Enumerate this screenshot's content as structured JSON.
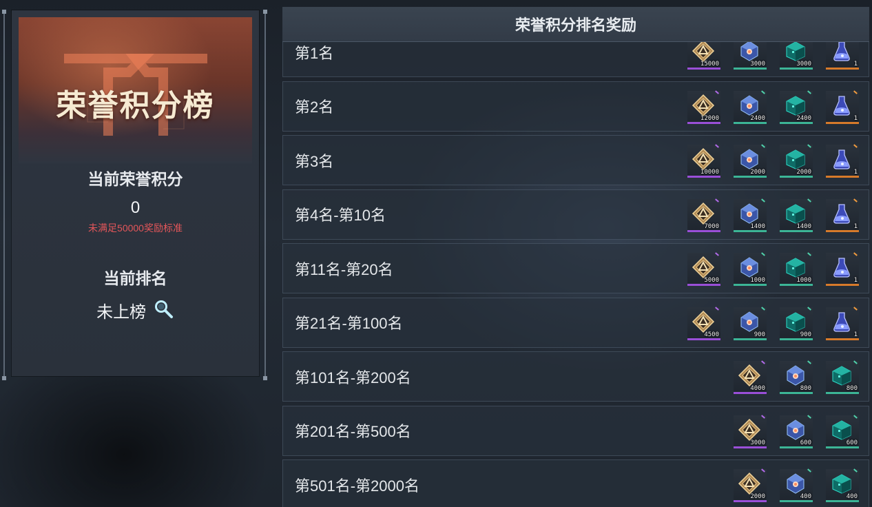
{
  "left": {
    "title": "荣誉积分榜",
    "current_score_label": "当前荣誉积分",
    "current_score_value": "0",
    "score_warning": "未满足50000奖励标准",
    "current_rank_label": "当前排名",
    "current_rank_value": "未上榜"
  },
  "right": {
    "header": "荣誉积分排名奖励",
    "rows": [
      {
        "rank": "第1名",
        "rewards": [
          {
            "icon": "honor-medal-icon",
            "rarity": "purple",
            "qty": "15000"
          },
          {
            "icon": "crystal-orb-icon",
            "rarity": "green",
            "qty": "3000"
          },
          {
            "icon": "teal-cube-icon",
            "rarity": "green",
            "qty": "3000"
          },
          {
            "icon": "blue-flask-icon",
            "rarity": "orange",
            "qty": "1"
          }
        ]
      },
      {
        "rank": "第2名",
        "rewards": [
          {
            "icon": "honor-medal-icon",
            "rarity": "purple",
            "qty": "12000"
          },
          {
            "icon": "crystal-orb-icon",
            "rarity": "green",
            "qty": "2400"
          },
          {
            "icon": "teal-cube-icon",
            "rarity": "green",
            "qty": "2400"
          },
          {
            "icon": "blue-flask-icon",
            "rarity": "orange",
            "qty": "1"
          }
        ]
      },
      {
        "rank": "第3名",
        "rewards": [
          {
            "icon": "honor-medal-icon",
            "rarity": "purple",
            "qty": "10000"
          },
          {
            "icon": "crystal-orb-icon",
            "rarity": "green",
            "qty": "2000"
          },
          {
            "icon": "teal-cube-icon",
            "rarity": "green",
            "qty": "2000"
          },
          {
            "icon": "blue-flask-icon",
            "rarity": "orange",
            "qty": "1"
          }
        ]
      },
      {
        "rank": "第4名-第10名",
        "rewards": [
          {
            "icon": "honor-medal-icon",
            "rarity": "purple",
            "qty": "7000"
          },
          {
            "icon": "crystal-orb-icon",
            "rarity": "green",
            "qty": "1400"
          },
          {
            "icon": "teal-cube-icon",
            "rarity": "green",
            "qty": "1400"
          },
          {
            "icon": "blue-flask-icon",
            "rarity": "orange",
            "qty": "1"
          }
        ]
      },
      {
        "rank": "第11名-第20名",
        "rewards": [
          {
            "icon": "honor-medal-icon",
            "rarity": "purple",
            "qty": "5000"
          },
          {
            "icon": "crystal-orb-icon",
            "rarity": "green",
            "qty": "1000"
          },
          {
            "icon": "teal-cube-icon",
            "rarity": "green",
            "qty": "1000"
          },
          {
            "icon": "blue-flask-icon",
            "rarity": "orange",
            "qty": "1"
          }
        ]
      },
      {
        "rank": "第21名-第100名",
        "rewards": [
          {
            "icon": "honor-medal-icon",
            "rarity": "purple",
            "qty": "4500"
          },
          {
            "icon": "crystal-orb-icon",
            "rarity": "green",
            "qty": "900"
          },
          {
            "icon": "teal-cube-icon",
            "rarity": "green",
            "qty": "900"
          },
          {
            "icon": "blue-flask-icon",
            "rarity": "orange",
            "qty": "1"
          }
        ]
      },
      {
        "rank": "第101名-第200名",
        "rewards": [
          {
            "icon": "honor-medal-icon",
            "rarity": "purple",
            "qty": "4000"
          },
          {
            "icon": "crystal-orb-icon",
            "rarity": "green",
            "qty": "800"
          },
          {
            "icon": "teal-cube-icon",
            "rarity": "green",
            "qty": "800"
          }
        ]
      },
      {
        "rank": "第201名-第500名",
        "rewards": [
          {
            "icon": "honor-medal-icon",
            "rarity": "purple",
            "qty": "3000"
          },
          {
            "icon": "crystal-orb-icon",
            "rarity": "green",
            "qty": "600"
          },
          {
            "icon": "teal-cube-icon",
            "rarity": "green",
            "qty": "600"
          }
        ]
      },
      {
        "rank": "第501名-第2000名",
        "rewards": [
          {
            "icon": "honor-medal-icon",
            "rarity": "purple",
            "qty": "2000"
          },
          {
            "icon": "crystal-orb-icon",
            "rarity": "green",
            "qty": "400"
          },
          {
            "icon": "teal-cube-icon",
            "rarity": "green",
            "qty": "400"
          }
        ]
      }
    ]
  },
  "colors": {
    "warning": "#e5565a",
    "rarity_purple": "#9a4fd8",
    "rarity_green": "#3cb596",
    "rarity_orange": "#d77a2a"
  }
}
